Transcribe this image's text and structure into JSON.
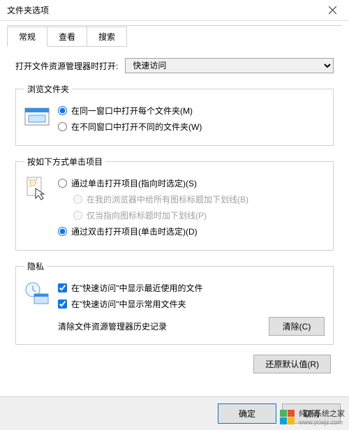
{
  "window": {
    "title": "文件夹选项"
  },
  "tabs": [
    "常规",
    "查看",
    "搜索"
  ],
  "open": {
    "label": "打开文件资源管理器时打开:",
    "value": "快速访问"
  },
  "browse": {
    "legend": "浏览文件夹",
    "same_window": "在同一窗口中打开每个文件夹(M)",
    "diff_window": "在不同窗口中打开不同的文件夹(W)"
  },
  "click": {
    "legend": "按如下方式单击项目",
    "single": "通过单击打开项目(指向时选定)(S)",
    "underline_all": "在我的浏览器中给所有图标标题加下划线(B)",
    "underline_point": "仅当指向图标标题时加下划线(P)",
    "double": "通过双击打开项目(单击时选定)(D)"
  },
  "privacy": {
    "legend": "隐私",
    "recent_files": "在\"快速访问\"中显示最近使用的文件",
    "frequent_folders": "在\"快速访问\"中显示常用文件夹",
    "clear_label": "清除文件资源管理器历史记录",
    "clear_btn": "清除(C)"
  },
  "restore": "还原默认值(R)",
  "footer": {
    "ok": "确定",
    "cancel": "取消"
  },
  "watermark": {
    "name": "纯净系统之家",
    "url": "www.ycwjz.com"
  }
}
